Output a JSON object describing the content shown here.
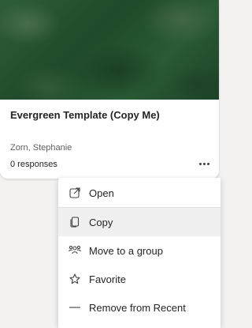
{
  "card": {
    "title": "Evergreen Template (Copy Me)",
    "owner": "Zorn, Stephanie",
    "responses": "0 responses",
    "more_icon": "more-horizontal-icon"
  },
  "menu": {
    "items": [
      {
        "label": "Open",
        "icon": "open-icon"
      },
      {
        "label": "Copy",
        "icon": "copy-icon"
      },
      {
        "label": "Move to a group",
        "icon": "people-group-icon"
      },
      {
        "label": "Favorite",
        "icon": "star-icon"
      },
      {
        "label": "Remove from Recent",
        "icon": "minus-icon"
      }
    ]
  },
  "colors": {
    "card_image": "#2f5d3a",
    "hover_row": "#f0f0f0",
    "background": "#f3f2f1"
  }
}
